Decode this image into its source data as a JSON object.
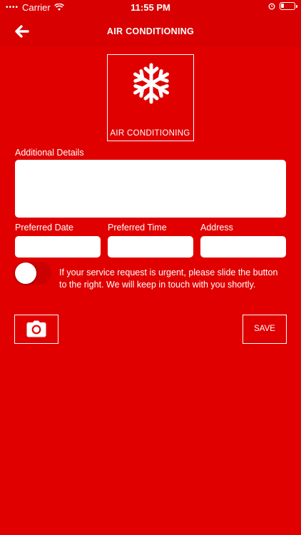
{
  "status_bar": {
    "carrier": "Carrier",
    "time": "11:55 PM"
  },
  "nav": {
    "title": "AIR CONDITIONING",
    "back_icon": "back-arrow-icon"
  },
  "category": {
    "label": "AIR CONDITIONING",
    "icon": "snowflake-icon"
  },
  "form": {
    "additional_details_label": "Additional Details",
    "additional_details_value": "",
    "preferred_date_label": "Preferred Date",
    "preferred_date_value": "",
    "preferred_time_label": "Preferred Time",
    "preferred_time_value": "",
    "address_label": "Address",
    "address_value": ""
  },
  "urgent": {
    "enabled": false,
    "text": "If your service request is urgent, please slide the button to the right. We will keep in touch with you shortly."
  },
  "actions": {
    "camera_icon": "camera-icon",
    "save_label": "SAVE"
  },
  "colors": {
    "background": "#e00000",
    "bar": "#d80000",
    "foreground": "#ffffff"
  }
}
